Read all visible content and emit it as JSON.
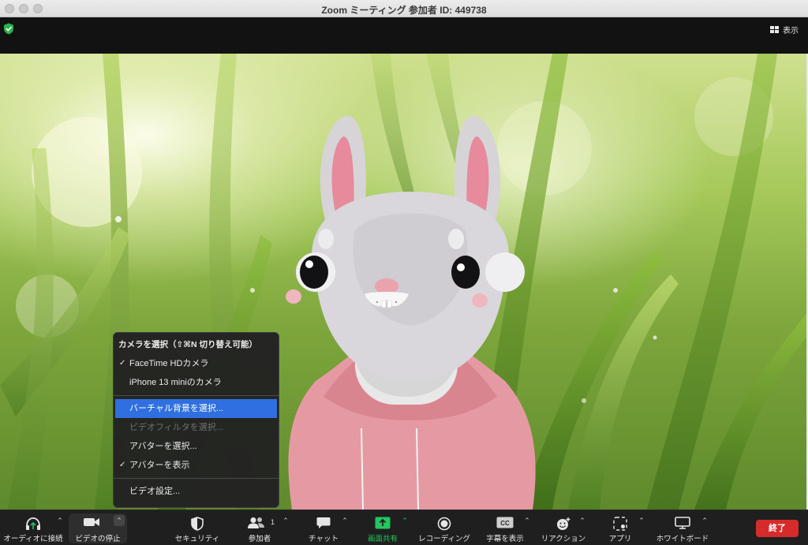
{
  "window": {
    "title": "Zoom ミーティング 参加者 ID: 449738"
  },
  "topbar": {
    "view_label": "表示"
  },
  "camera_menu": {
    "header": "カメラを選択（⇧⌘N 切り替え可能）",
    "cameras": [
      {
        "label": "FaceTime HDカメラ",
        "checked": true
      },
      {
        "label": "iPhone 13 miniのカメラ",
        "checked": false
      }
    ],
    "virtual_background": "バーチャル背景を選択...",
    "video_filter": "ビデオフィルタを選択...",
    "avatar_select": "アバターを選択...",
    "avatar_show": "アバターを表示",
    "video_settings": "ビデオ設定...",
    "check_mark": "✓"
  },
  "toolbar": {
    "audio": "オーディオに接続",
    "video": "ビデオの停止",
    "security": "セキュリティ",
    "participants": "参加者",
    "participants_count": "1",
    "chat": "チャット",
    "share": "画面共有",
    "record": "レコーディング",
    "captions": "字幕を表示",
    "captions_icon_text": "CC",
    "reactions": "リアクション",
    "apps": "アプリ",
    "whiteboard": "ホワイトボード",
    "end": "終了"
  },
  "colors": {
    "share_green": "#22c55e",
    "menu_highlight": "#2f6fe0",
    "end_red": "#d62b2b",
    "hoodie_pink": "#e59aa3"
  }
}
